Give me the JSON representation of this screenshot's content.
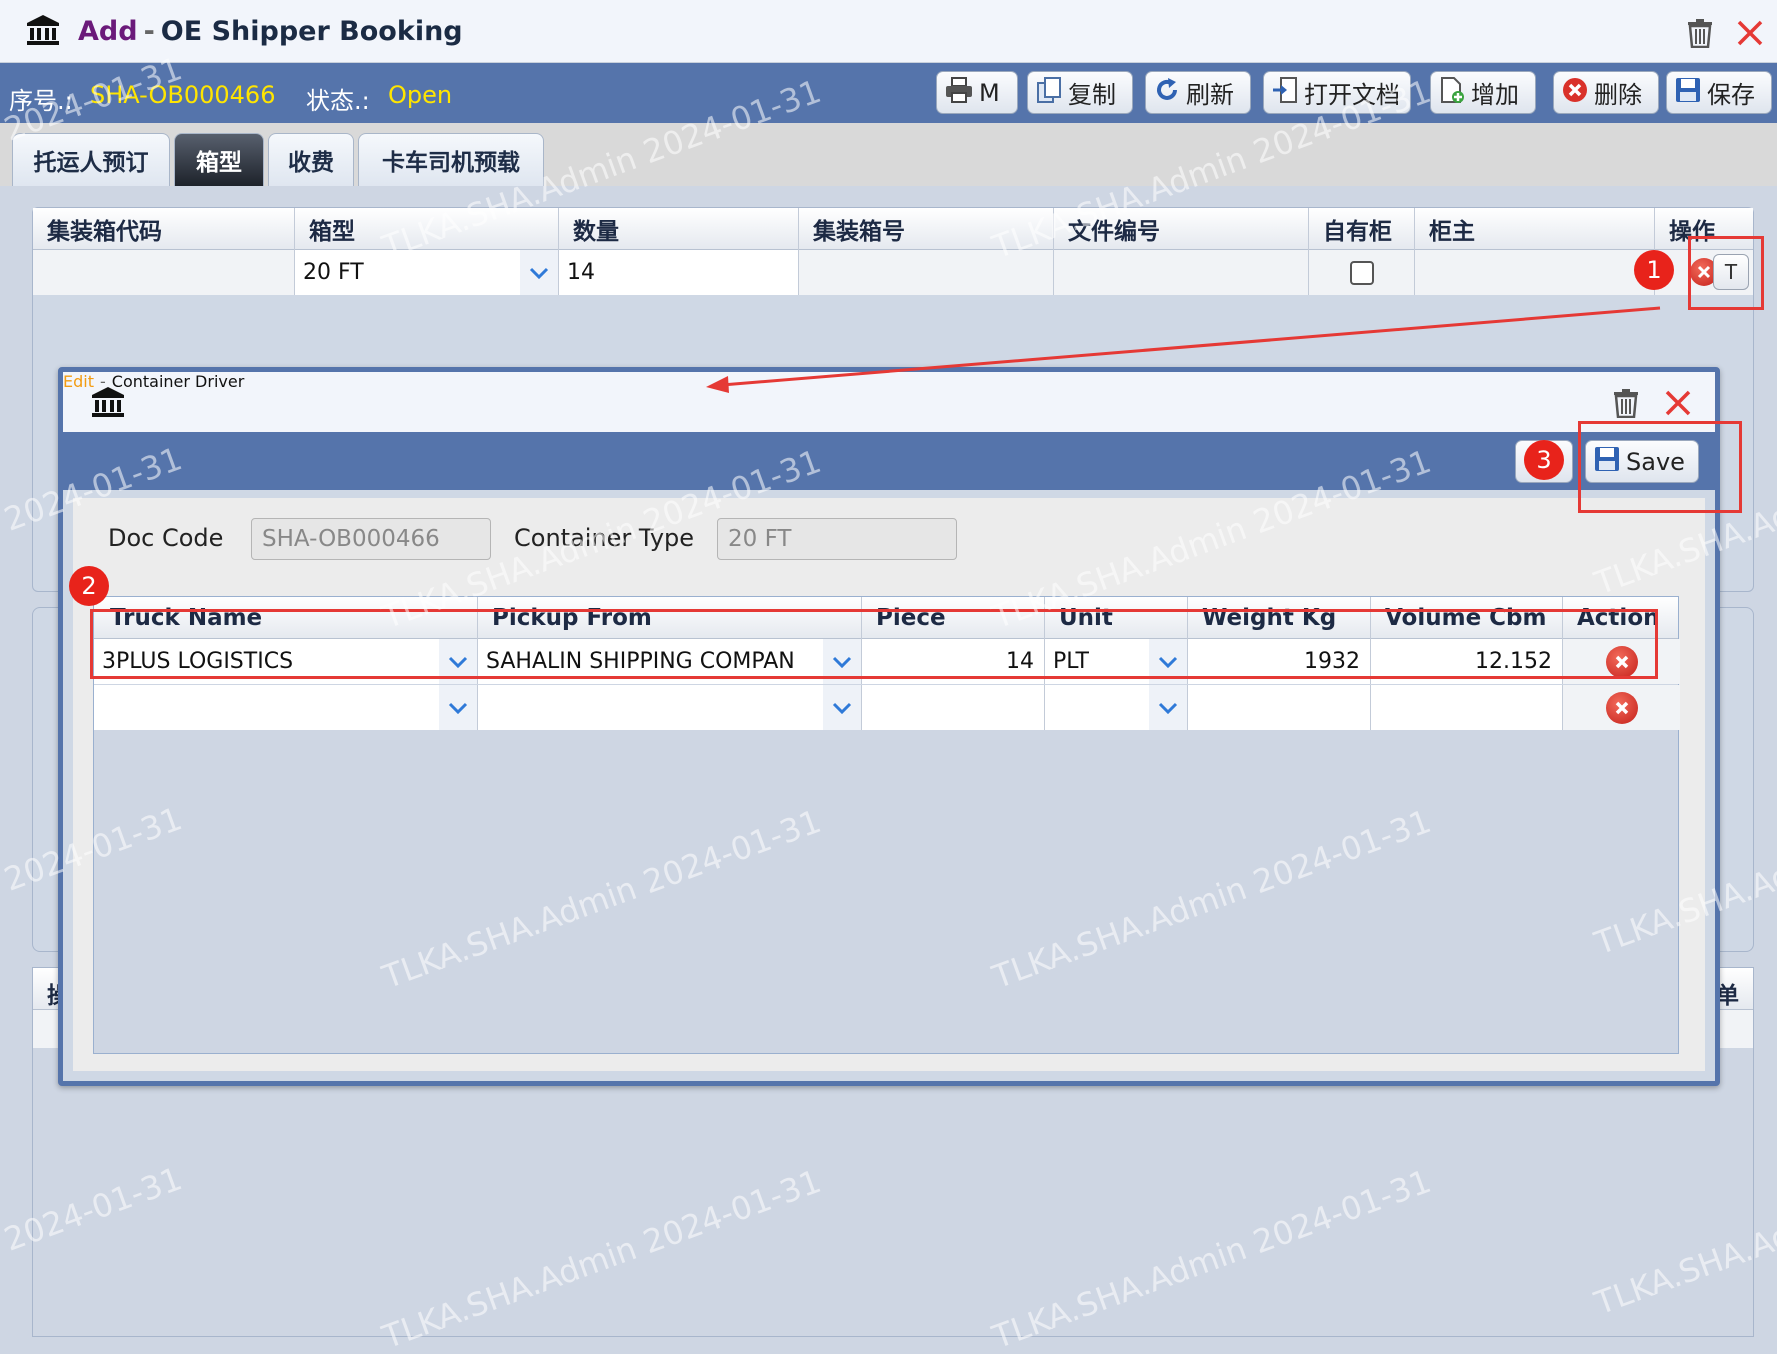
{
  "window": {
    "mode": "Add",
    "separator": "-",
    "title": "OE Shipper Booking"
  },
  "toolbar": {
    "seq_label": "序号.:",
    "seq_value": "SHA-OB000466",
    "status_label": "状态.:",
    "status_value": "Open",
    "buttons": {
      "print": "M",
      "copy": "复制",
      "refresh": "刷新",
      "open_doc": "打开文档",
      "add": "增加",
      "delete": "删除",
      "save": "保存"
    }
  },
  "tabs": [
    "托运人预订",
    "箱型",
    "收费",
    "卡车司机预载"
  ],
  "container_grid": {
    "columns": [
      "集装箱代码",
      "箱型",
      "数量",
      "集装箱号",
      "文件编号",
      "自有柜",
      "柜主",
      "操作"
    ],
    "row": {
      "code": "",
      "type": "20 FT",
      "quantity": "14",
      "container_no": "",
      "file_no": "",
      "own_container": false,
      "owner": "",
      "action_button": "T"
    }
  },
  "bottom_panel": {
    "left_partial": "操",
    "right_partial": "单"
  },
  "dialog": {
    "mode": "Edit",
    "separator": "-",
    "title": "Container Driver",
    "save_label": "Save",
    "doc_code_label": "Doc Code",
    "doc_code_value": "SHA-OB000466",
    "container_type_label": "Container Type",
    "container_type_value": "20 FT",
    "columns": [
      "Truck Name",
      "Pickup From",
      "Piece",
      "Unit",
      "Weight Kg",
      "Volume Cbm",
      "Action"
    ],
    "rows": [
      {
        "truck_name": "3PLUS LOGISTICS",
        "pickup_from": "SAHALIN SHIPPING COMPAN",
        "piece": "14",
        "unit": "PLT",
        "weight": "1932",
        "volume": "12.152"
      },
      {
        "truck_name": "",
        "pickup_from": "",
        "piece": "",
        "unit": "",
        "weight": "",
        "volume": ""
      }
    ]
  },
  "annotations": {
    "step1": "1",
    "step2": "2",
    "step3": "3"
  },
  "watermark": {
    "user": "TLKA.SHA.Admin 2024-01-31",
    "date": "2024-01-31",
    "partial": "TLKA.SHA.Ad"
  },
  "colors": {
    "accent": "#5574ab",
    "status_value": "#ffe500",
    "mode_add": "#6b1a7a",
    "mode_edit": "#f39c12",
    "annotation": "#e53935"
  }
}
